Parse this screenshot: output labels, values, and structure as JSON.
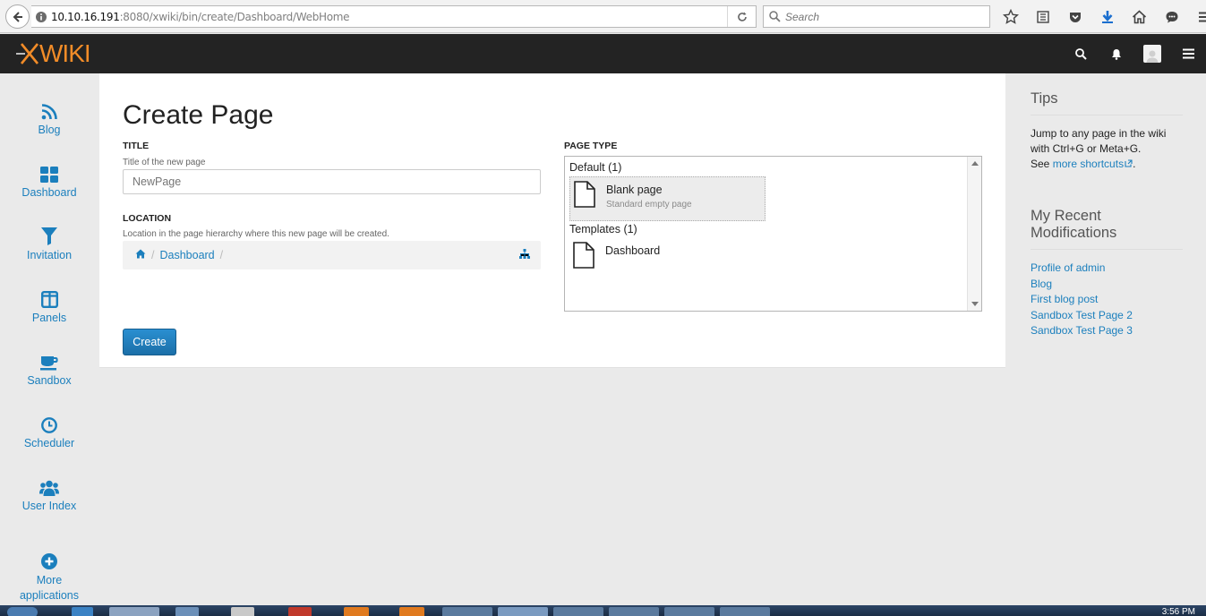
{
  "browser": {
    "url_host": "10.10.16.191",
    "url_rest": ":8080/xwiki/bin/create/Dashboard/WebHome",
    "search_placeholder": "Search"
  },
  "header": {
    "logo_text": "XWIKI"
  },
  "appbar": {
    "items": [
      {
        "label": "Blog",
        "icon": "rss-icon"
      },
      {
        "label": "Dashboard",
        "icon": "dashboard-icon"
      },
      {
        "label": "Invitation",
        "icon": "funnel-icon"
      },
      {
        "label": "Panels",
        "icon": "panels-icon"
      },
      {
        "label": "Sandbox",
        "icon": "coffee-icon"
      },
      {
        "label": "Scheduler",
        "icon": "clock-icon"
      },
      {
        "label": "User Index",
        "icon": "users-icon"
      },
      {
        "label": "More applications",
        "icon": "plus-circle-icon"
      }
    ]
  },
  "main": {
    "title": "Create Page",
    "title_field": {
      "heading": "TITLE",
      "hint": "Title of the new page",
      "placeholder": "NewPage"
    },
    "location_field": {
      "heading": "LOCATION",
      "hint": "Location in the page hierarchy where this new page will be created.",
      "crumb": "Dashboard",
      "separator": "/"
    },
    "page_type": {
      "heading": "PAGE TYPE",
      "default_group": "Default (1)",
      "templates_group": "Templates (1)",
      "blank_name": "Blank page",
      "blank_desc": "Standard empty page",
      "dashboard_name": "Dashboard"
    },
    "create_label": "Create"
  },
  "tips": {
    "title": "Tips",
    "line1": "Jump to any page in the wiki with Ctrl+G or Meta+G.",
    "see": "See",
    "shortcuts_link": "more shortcuts",
    "period": "."
  },
  "recent": {
    "title": "My Recent Modifications",
    "items": [
      "Profile of admin",
      "Blog",
      "First blog post",
      "Sandbox Test Page 2",
      "Sandbox Test Page 3"
    ]
  },
  "taskbar": {
    "clock": "3:56 PM"
  },
  "colors": {
    "accent": "#1b7fbd",
    "header_bg": "#232323",
    "logo": "#f28c28"
  }
}
